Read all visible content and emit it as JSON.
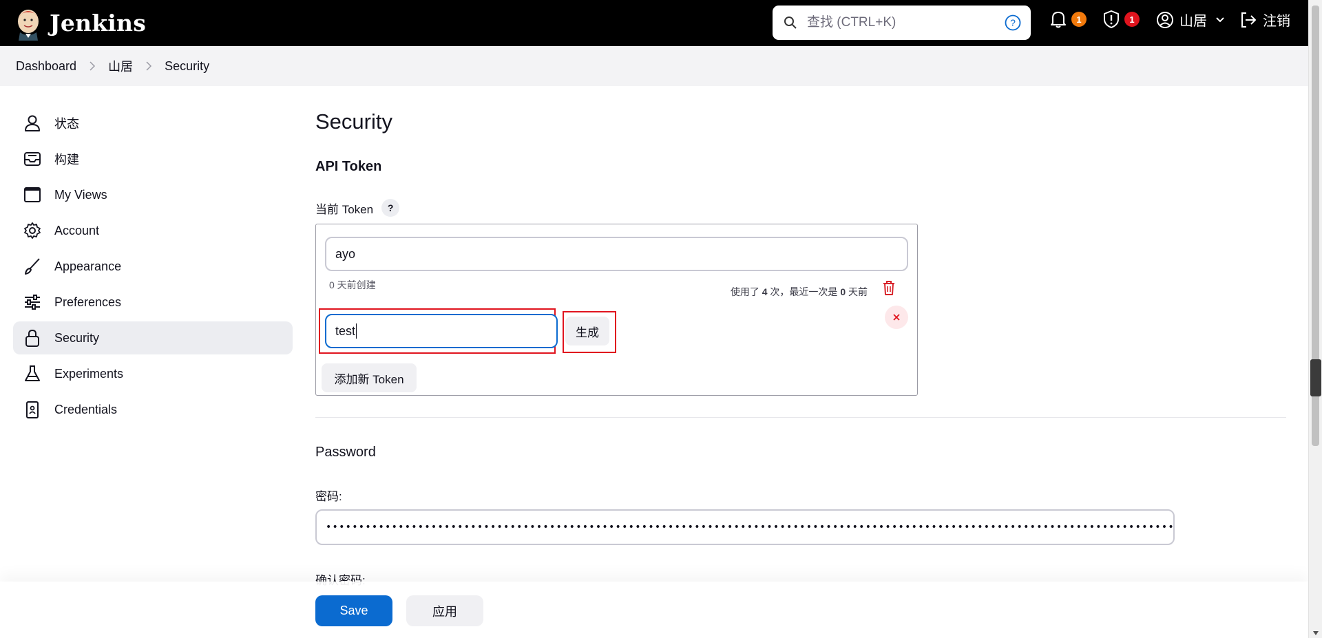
{
  "header": {
    "app_name": "Jenkins",
    "search_placeholder": "查找 (CTRL+K)",
    "notifications_count": "1",
    "security_count": "1",
    "user_name": "山居",
    "logout_label": "注销",
    "colors": {
      "notif_badge": "#f27a0c",
      "security_badge": "#e0141e"
    }
  },
  "breadcrumb": [
    "Dashboard",
    "山居",
    "Security"
  ],
  "sidebar": {
    "items": [
      {
        "label": "状态",
        "icon": "person-icon"
      },
      {
        "label": "构建",
        "icon": "inbox-icon"
      },
      {
        "label": "My Views",
        "icon": "window-icon"
      },
      {
        "label": "Account",
        "icon": "gear-icon"
      },
      {
        "label": "Appearance",
        "icon": "brush-icon"
      },
      {
        "label": "Preferences",
        "icon": "sliders-icon"
      },
      {
        "label": "Security",
        "icon": "lock-icon",
        "active": true
      },
      {
        "label": "Experiments",
        "icon": "flask-icon"
      },
      {
        "label": "Credentials",
        "icon": "id-card-icon"
      }
    ]
  },
  "main": {
    "title": "Security",
    "api_token": {
      "heading": "API Token",
      "current_label": "当前 Token",
      "help": "?",
      "existing_token_name": "ayo",
      "created_text": "0 天前创建",
      "usage_prefix": "使用了",
      "usage_count": "4",
      "usage_mid": "次，最近一次是",
      "usage_days": "0",
      "usage_suffix": "天前",
      "new_token_value": "test",
      "generate_label": "生成",
      "add_token_label": "添加新 Token"
    },
    "password": {
      "heading": "Password",
      "password_label": "密码:",
      "password_value": "•••••••••••••••••••••••••••••••••••••••••••••••••••••••••••••••••••••••••••••••••••••••••••••••••••••••••••••••••••••••••••••••••••••••••••••••••",
      "confirm_label": "确认密码:"
    }
  },
  "actions": {
    "save_label": "Save",
    "apply_label": "应用"
  }
}
